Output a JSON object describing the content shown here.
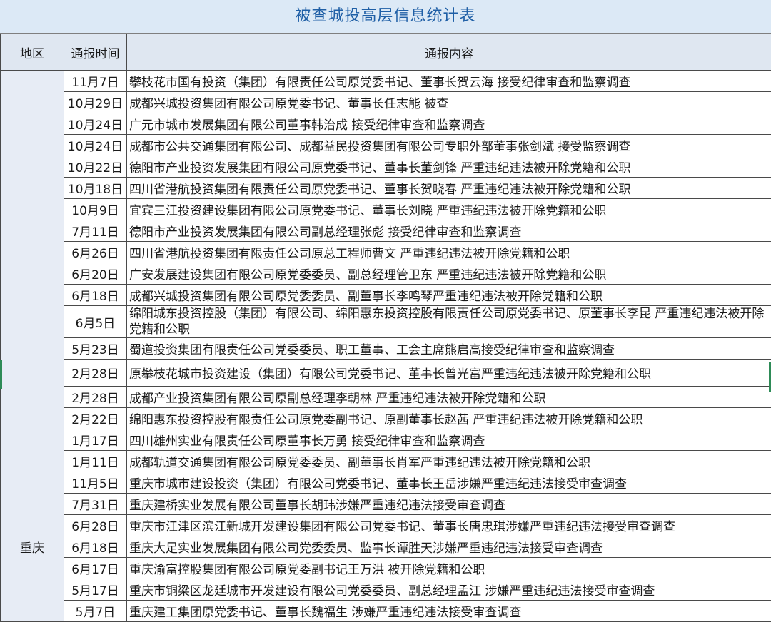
{
  "title": "被查城投高层信息统计表",
  "headers": {
    "region": "地区",
    "date": "通报时间",
    "content": "通报内容"
  },
  "regions": [
    {
      "name": "",
      "rows": [
        {
          "date": "11月7日",
          "content": "攀枝花市国有投资（集团）有限责任公司原党委书记、董事长贺云海  接受纪律审查和监察调查"
        },
        {
          "date": "10月29日",
          "content": "成都兴城投资集团有限公司原党委书记、董事长任志能  被查"
        },
        {
          "date": "10月24日",
          "content": "广元市城市发展集团有限公司董事韩治成  接受纪律审查和监察调查"
        },
        {
          "date": "10月24日",
          "content": "成都市公共交通集团有限公司、成都益民投资集团有限公司专职外部董事张剑斌  接受监察调查"
        },
        {
          "date": "10月22日",
          "content": "德阳市产业投资发展集团有限公司原党委书记、董事长董剑锋  严重违纪违法被开除党籍和公职"
        },
        {
          "date": "10月18日",
          "content": "四川省港航投资集团有限责任公司原党委书记、董事长贺晓春  严重违纪违法被开除党籍和公职"
        },
        {
          "date": "10月9日",
          "content": "宜宾三江投资建设集团有限公司原党委书记、董事长刘晓  严重违纪违法被开除党籍和公职"
        },
        {
          "date": "7月11日",
          "content": "德阳市产业投资发展集团有限公司副总经理张彪  接受纪律审查和监察调查"
        },
        {
          "date": "6月26日",
          "content": "四川省港航投资集团有限责任公司原总工程师曹文  严重违纪违法被开除党籍和公职"
        },
        {
          "date": "6月20日",
          "content": "广安发展建设集团有限公司原党委委员、副总经理管卫东  严重违纪违法被开除党籍和公职"
        },
        {
          "date": "6月18日",
          "content": "成都兴城投资集团有限公司原党委委员、副董事长李鸣琴严重违纪违法被开除党籍和公职"
        },
        {
          "date": "6月5日",
          "content": "绵阳城东投资控股（集团）有限公司、绵阳惠东投资控股有限责任公司原党委书记、原董事长李昆  严重违纪违法被开除党籍和公职"
        },
        {
          "date": "5月23日",
          "content": "蜀道投资集团有限责任公司党委委员、职工董事、工会主席熊启高接受纪律审查和监察调查"
        },
        {
          "date": "2月28日",
          "content": "原攀枝花城市投资建设（集团）有限公司党委书记、董事长曾光富严重违纪违法被开除党籍和公职"
        },
        {
          "date": "2月28日",
          "content": "成都产业投资集团有限公司原副总经理李朝林  严重违纪违法被开除党籍和公职"
        },
        {
          "date": "2月22日",
          "content": "绵阳惠东投资控股有限责任公司原党委副书记、原副董事长赵茜  严重违纪违法被开除党籍和公职"
        },
        {
          "date": "1月17日",
          "content": "四川雄州实业有限责任公司原董事长万勇  接受纪律审查和监察调查"
        },
        {
          "date": "1月11日",
          "content": "成都轨道交通集团有限公司原党委委员、副董事长肖军严重违纪违法被开除党籍和公职"
        }
      ]
    },
    {
      "name": "重庆",
      "rows": [
        {
          "date": "11月5日",
          "content": "重庆市城市建设投资（集团）有限公司党委书记、董事长王岳涉嫌严重违纪违法接受审查调查"
        },
        {
          "date": "7月31日",
          "content": "重庆建桥实业发展有限公司董事长胡玮涉嫌严重违纪违法接受审查调查"
        },
        {
          "date": "6月28日",
          "content": "重庆市江津区滨江新城开发建设集团有限公司党委书记、董事长唐忠琪涉嫌严重违纪违法接受审查调查"
        },
        {
          "date": "6月18日",
          "content": "重庆大足实业发展集团有限公司党委委员、监事长谭胜天涉嫌严重违纪违法接受审查调查"
        },
        {
          "date": "6月17日",
          "content": "重庆渝富控股集团有限公司原党委副书记王万洪  被开除党籍和公职"
        },
        {
          "date": "5月17日",
          "content": "重庆市铜梁区龙廷城市开发建设有限公司党委委员、副总经理孟江  涉嫌严重违纪违法接受审查调查"
        },
        {
          "date": "5月7日",
          "content": "重庆建工集团原党委书记、董事长魏福生  涉嫌严重违纪违法接受审查调查"
        }
      ]
    }
  ]
}
